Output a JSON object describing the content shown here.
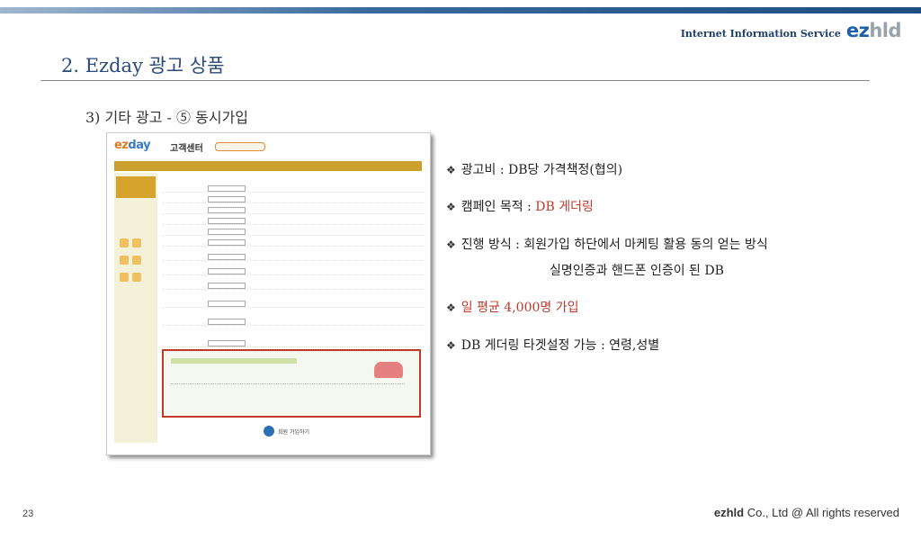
{
  "header": {
    "service_name": "Internet Information Service",
    "logo_ez": "ez",
    "logo_hld": "hld"
  },
  "page": {
    "title": "2. Ezday 광고 상품",
    "subtitle": "3) 기타 광고 - ⑤ 동시가입"
  },
  "screenshot": {
    "logo_main": "ez",
    "logo_accent": "day",
    "page_name": "고객센터",
    "join_button": "회원 가입하기"
  },
  "bullets": [
    {
      "label": "광고비 : ",
      "value": "DB당 가격책정(협의)",
      "highlight": false
    },
    {
      "label": "캠페인 목적 : ",
      "value": "DB 게더링",
      "highlight": "value"
    },
    {
      "label": "진행 방식 : ",
      "value": "회원가입 하단에서 마케팅 활용 동의 얻는 방식",
      "highlight": false,
      "continuation": "실명인증과 핸드폰 인증이 된 DB"
    },
    {
      "label": "",
      "value": "일 평균 4,000명 가입",
      "highlight": "all"
    },
    {
      "label": "DB 게더링 타겟설정 가능 : ",
      "value": "연령,성별",
      "highlight": false
    }
  ],
  "footer": {
    "page_number": "23",
    "company_bold": "ezhld",
    "copyright": " Co., Ltd @ All rights reserved"
  },
  "colors": {
    "accent_red": "#c0392b",
    "title_blue": "#2b4a7a",
    "brand_blue": "#1f5fa8"
  }
}
